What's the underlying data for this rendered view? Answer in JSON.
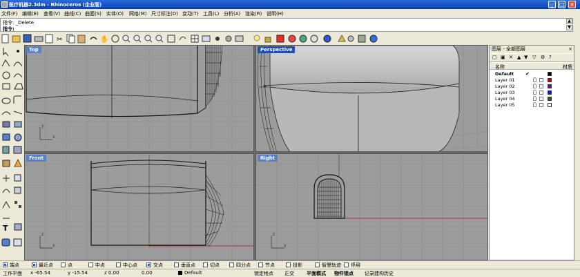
{
  "window": {
    "title": "医疗机器2.3dm - Rhinoceros (企业版)"
  },
  "menu": [
    "文件(F)",
    "编辑(E)",
    "查看(V)",
    "曲线(C)",
    "曲面(S)",
    "实体(O)",
    "网格(M)",
    "尺寸标注(D)",
    "变动(T)",
    "工具(L)",
    "分析(A)",
    "渲染(R)",
    "说明(H)"
  ],
  "command_history": {
    "line1": "指令: _Delete",
    "line2": "指令:"
  },
  "viewports": {
    "top": "Top",
    "perspective": "Perspective",
    "front": "Front",
    "right": "Right"
  },
  "layers": {
    "panel_title": "图层 - 全部图层",
    "col_name": "名称",
    "col_material": "材质",
    "rows": [
      {
        "name": "Default",
        "current": "✔",
        "color": "#000000"
      },
      {
        "name": "Layer 01",
        "color": "#cc0000"
      },
      {
        "name": "Layer 02",
        "color": "#6a0dad"
      },
      {
        "name": "Layer 03",
        "color": "#1a1acc"
      },
      {
        "name": "Layer 04",
        "color": "#0a7a0a"
      },
      {
        "name": "Layer 05",
        "color": "#ffffff"
      }
    ]
  },
  "osnaps": [
    {
      "label": "端点",
      "checked": true
    },
    {
      "label": "最近点",
      "checked": true
    },
    {
      "label": "点",
      "checked": false
    },
    {
      "label": "中点",
      "checked": false
    },
    {
      "label": "中心点",
      "checked": false
    },
    {
      "label": "交点",
      "checked": true
    },
    {
      "label": "垂直点",
      "checked": false
    },
    {
      "label": "切点",
      "checked": false
    },
    {
      "label": "四分点",
      "checked": false
    },
    {
      "label": "节点",
      "checked": false
    },
    {
      "label": "投影",
      "checked": false
    },
    {
      "label": "智慧轨迹",
      "checked": false
    },
    {
      "label": "停用",
      "checked": false
    }
  ],
  "status": {
    "cplane": "工作平面",
    "x": "x -65.54",
    "y": "y -15.54",
    "z": "z 0.00",
    "dist": "0.00",
    "layer": "Default",
    "lock_grid": "锁定格点",
    "ortho": "正交",
    "planar": "平面模式",
    "osnap": "物件锁点",
    "history": "记录建构历史"
  }
}
